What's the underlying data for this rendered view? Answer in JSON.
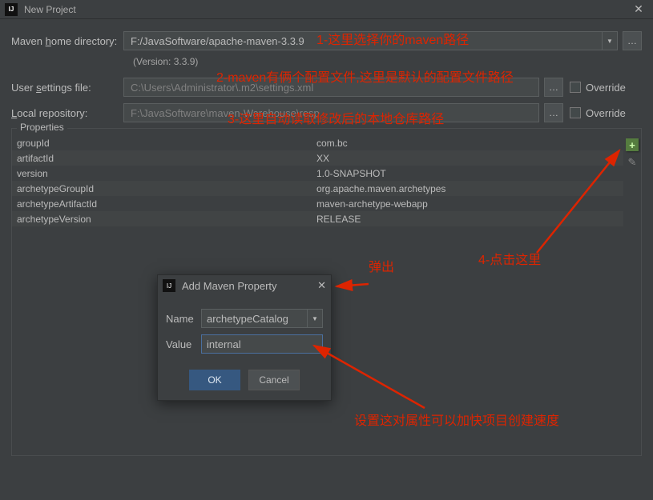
{
  "titlebar": {
    "title": "New Project"
  },
  "rows": {
    "maven_home": {
      "label": "Maven home directory:",
      "value": "F:/JavaSoftware/apache-maven-3.3.9"
    },
    "version_info": "(Version: 3.3.9)",
    "user_settings": {
      "label": "User settings file:",
      "value": "C:\\Users\\Administrator\\.m2\\settings.xml",
      "override": "Override"
    },
    "local_repo": {
      "label": "Local repository:",
      "value": "F:\\JavaSoftware\\maven-Warehouse\\resp",
      "override": "Override"
    }
  },
  "properties": {
    "title": "Properties",
    "items": [
      {
        "k": "groupId",
        "v": "com.bc"
      },
      {
        "k": "artifactId",
        "v": "XX"
      },
      {
        "k": "version",
        "v": "1.0-SNAPSHOT"
      },
      {
        "k": "archetypeGroupId",
        "v": "org.apache.maven.archetypes"
      },
      {
        "k": "archetypeArtifactId",
        "v": "maven-archetype-webapp"
      },
      {
        "k": "archetypeVersion",
        "v": "RELEASE"
      }
    ]
  },
  "dialog": {
    "title": "Add Maven Property",
    "name_label": "Name",
    "name_value": "archetypeCatalog",
    "value_label": "Value",
    "value_value": "internal",
    "ok": "OK",
    "cancel": "Cancel"
  },
  "annotations": {
    "a1": "1-这里选择你的maven路径",
    "a2": "2-maven有俩个配置文件,这里是默认的配置文件路径",
    "a3": "3-这里自动读取修改后的本地仓库路径",
    "a4": "4-点击这里",
    "popup": "弹出",
    "bottom": "设置这对属性可以加快项目创建速度"
  }
}
